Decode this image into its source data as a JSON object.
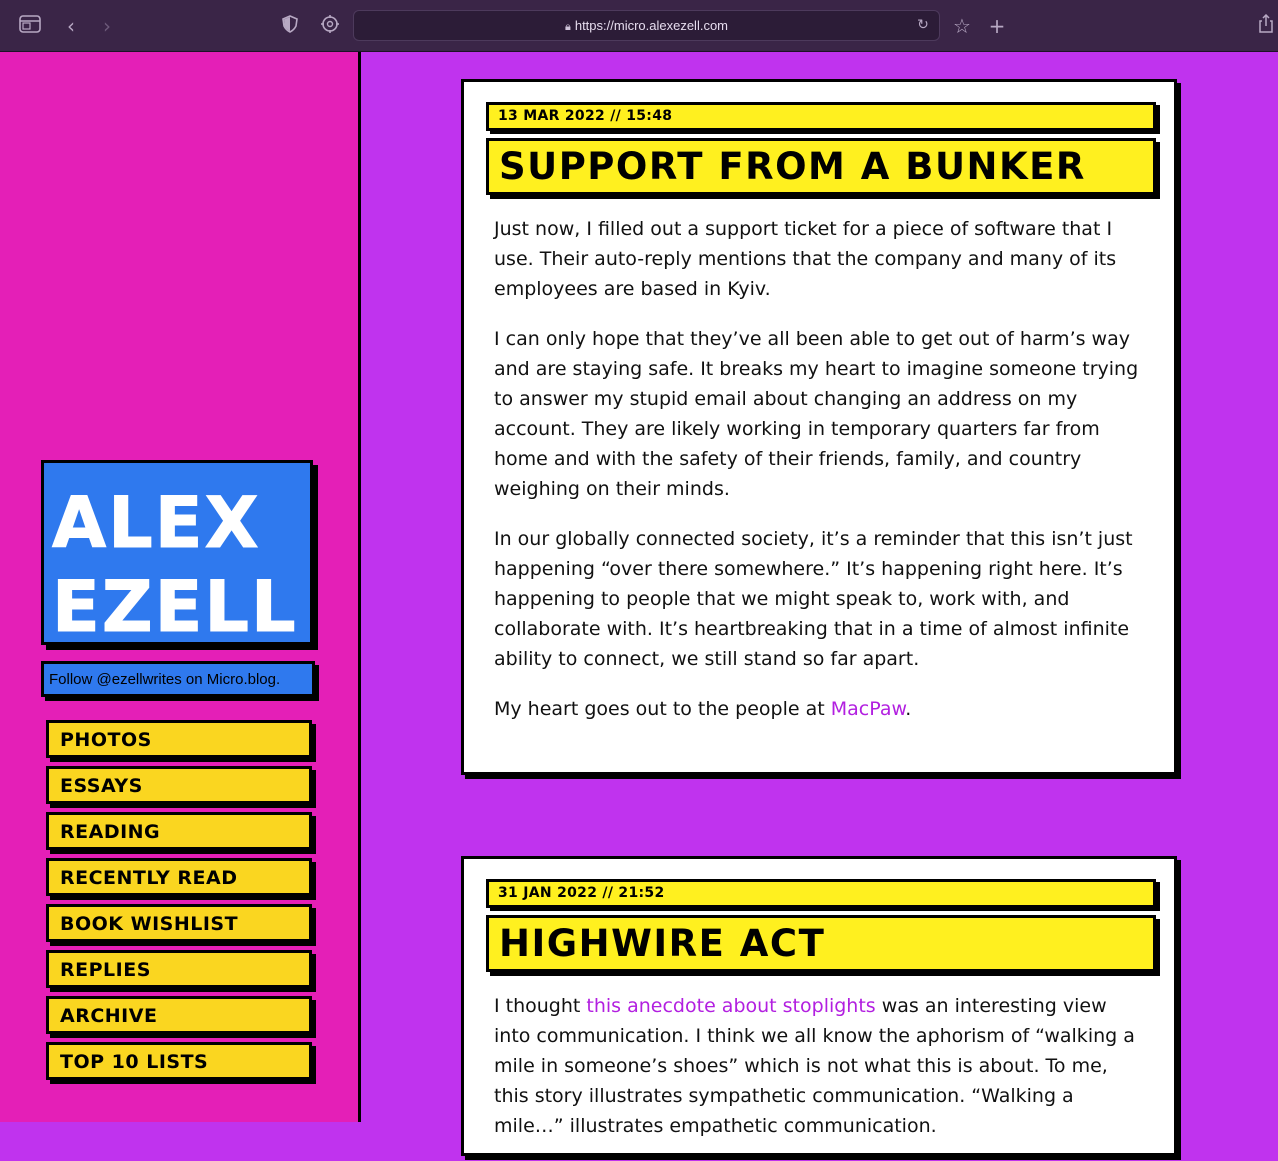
{
  "browser": {
    "url": "https://micro.alexezell.com",
    "icons": [
      "sidebar-icon",
      "back-icon",
      "forward-icon",
      "shield-icon",
      "privacy-report-icon",
      "lock-icon",
      "reload-icon",
      "bookmark-star-icon",
      "new-tab-icon",
      "share-icon"
    ]
  },
  "sidebar": {
    "title_line1": "Alex",
    "title_line2": "Ezell",
    "follow": "Follow @ezellwrites on Micro.blog.",
    "nav": [
      {
        "label": "Photos"
      },
      {
        "label": "Essays"
      },
      {
        "label": "Reading"
      },
      {
        "label": "Recently Read"
      },
      {
        "label": "Book Wishlist"
      },
      {
        "label": "Replies"
      },
      {
        "label": "Archive"
      },
      {
        "label": "Top 10 Lists"
      }
    ]
  },
  "posts": [
    {
      "date": "13 Mar 2022 // 15:48",
      "title": "Support from a bunker",
      "p1": "Just now, I filled out a support ticket for a piece of software that I use. Their auto-reply mentions that the company and many of its employees are based in Kyiv.",
      "p2": "I can only hope that they’ve all been able to get out of harm’s way and are staying safe. It breaks my heart to imagine someone trying to answer my stupid email about changing an address on my account. They are likely working in temporary quarters far from home and with the safety of their friends, family, and country weighing on their minds.",
      "p3": "In our globally connected society, it’s a reminder that this isn’t just happening “over there somewhere.” It’s happening right here. It’s happening to people that we might speak to, work with, and collaborate with. It’s heartbreaking that in a time of almost infinite ability to connect, we still stand so far apart.",
      "p4_before": "My heart goes out to the people at ",
      "p4_link": "MacPaw",
      "p4_after": "."
    },
    {
      "date": "31 Jan 2022 // 21:52",
      "title": "Highwire act",
      "p1_before": "I thought ",
      "p1_link": "this anecdote about stoplights",
      "p1_after": " was an interesting view into communication. I think we all know the aphorism of “walking a mile in someone’s shoes” which is not what this is about. To me, this story illustrates sympathetic communication. “Walking a mile…” illustrates empathetic communication."
    }
  ],
  "colors": {
    "page_bg": "#c033ee",
    "sidebar_bg": "#e41fb7",
    "title_box": "#2f79ee",
    "nav_item": "#fad620",
    "post_header": "#fff01f",
    "link": "#b21fe0"
  }
}
